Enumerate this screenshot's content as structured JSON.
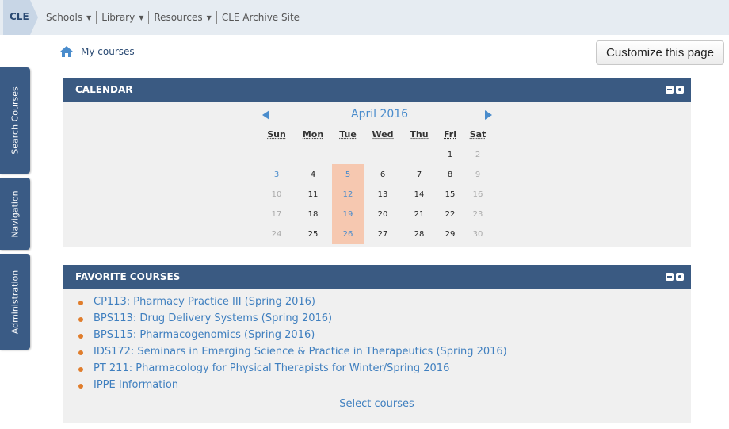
{
  "topnav": {
    "brand": "CLE",
    "menu": [
      {
        "label": "Schools",
        "caret": true
      },
      {
        "label": "Library",
        "caret": true
      },
      {
        "label": "Resources",
        "caret": true
      },
      {
        "label": "CLE Archive Site",
        "caret": false
      }
    ]
  },
  "breadcrumb": {
    "icon": "home-icon",
    "label": "My courses"
  },
  "customize_button": "Customize this page",
  "side_tabs": [
    "Search Courses",
    "Navigation",
    "Administration"
  ],
  "calendar": {
    "title": "CALENDAR",
    "month": "April 2016",
    "day_names": [
      "Sun",
      "Mon",
      "Tue",
      "Wed",
      "Thu",
      "Fri",
      "Sat"
    ],
    "weeks": [
      [
        "",
        "",
        "",
        "",
        "",
        "1",
        "2"
      ],
      [
        "3",
        "4",
        "5",
        "6",
        "7",
        "8",
        "9"
      ],
      [
        "10",
        "11",
        "12",
        "13",
        "14",
        "15",
        "16"
      ],
      [
        "17",
        "18",
        "19",
        "20",
        "21",
        "22",
        "23"
      ],
      [
        "24",
        "25",
        "26",
        "27",
        "28",
        "29",
        "30"
      ]
    ],
    "highlight_column": "Tue",
    "colors": {
      "header": "#3a5a82",
      "highlight": "#f6c8b0",
      "link": "#4a8ccc"
    }
  },
  "favorites": {
    "title": "FAVORITE COURSES",
    "courses": [
      "CP113: Pharmacy Practice III (Spring 2016)",
      "BPS113: Drug Delivery Systems (Spring 2016)",
      "BPS115: Pharmacogenomics (Spring 2016)",
      "IDS172: Seminars in Emerging Science & Practice in Therapeutics (Spring 2016)",
      "PT 211: Pharmacology for Physical Therapists for Winter/Spring 2016",
      "IPPE Information"
    ],
    "select_link": "Select courses"
  }
}
